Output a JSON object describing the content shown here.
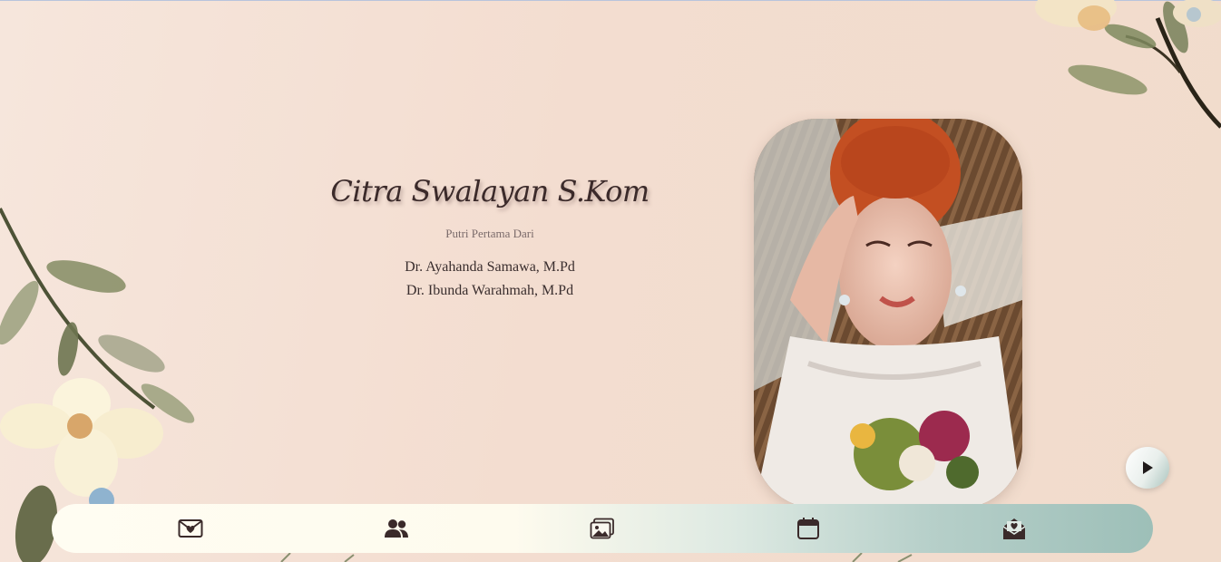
{
  "bride": {
    "name": "Citra Swalayan S.Kom",
    "subtitle": "Putri Pertama Dari",
    "father": "Dr. Ayahanda Samawa, M.Pd",
    "mother": "Dr. Ibunda Warahmah, M.Pd"
  },
  "music_button": {
    "icon": "play-icon"
  },
  "nav": {
    "items": [
      {
        "icon": "envelope-heart-icon"
      },
      {
        "icon": "couple-icon"
      },
      {
        "icon": "gallery-icon"
      },
      {
        "icon": "calendar-icon"
      },
      {
        "icon": "mail-open-heart-icon"
      }
    ]
  },
  "colors": {
    "background": "#f3ddd0",
    "text_dark": "#3b2a2a",
    "nav_start": "#fffdf2",
    "nav_end": "#9dbfb8"
  }
}
